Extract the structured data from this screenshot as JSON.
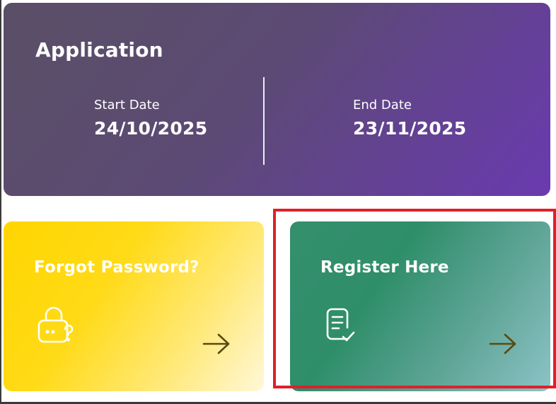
{
  "application": {
    "title": "Application",
    "start_label": "Start Date",
    "start_value": "24/10/2025",
    "end_label": "End Date",
    "end_value": "23/11/2025"
  },
  "forgot": {
    "title": "Forgot Password?",
    "icon": "lock-question-icon",
    "arrow_icon": "arrow-right-icon"
  },
  "register": {
    "title": "Register Here",
    "icon": "document-check-icon",
    "arrow_icon": "arrow-right-icon"
  },
  "colors": {
    "application_gradient_start": "#5a4f66",
    "application_gradient_end": "#6a3ab0",
    "forgot_gradient_start": "#ffd600",
    "register_gradient_start": "#348f6d",
    "register_gradient_end": "#8cc3c6",
    "arrow": "#5a4a10",
    "highlight": "#e0202a"
  }
}
